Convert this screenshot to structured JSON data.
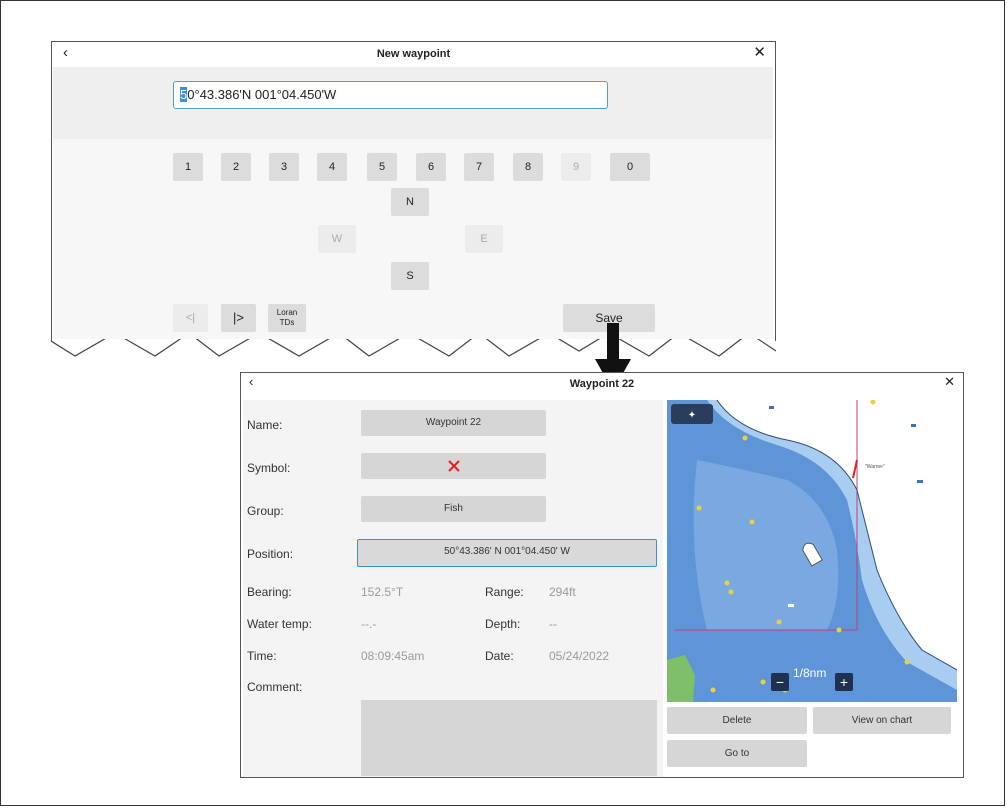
{
  "new_waypoint_dialog": {
    "back_icon": "chevron-left-icon",
    "title": "New waypoint",
    "close_icon": "close-icon",
    "position_first_char": "5",
    "position_rest": "0°43.386'N  001°04.450'W",
    "digit_keys": [
      "1",
      "2",
      "3",
      "4",
      "5",
      "6",
      "7",
      "8",
      "9",
      "0"
    ],
    "disabled_digit": "9",
    "dir_keys": {
      "n": "N",
      "w": "W",
      "e": "E",
      "s": "S"
    },
    "cursor_left_label": "<|",
    "cursor_right_label": "|>",
    "loran_label_1": "Loran",
    "loran_label_2": "TDs",
    "save_label": "Save"
  },
  "waypoint_dialog": {
    "back_icon": "chevron-left-icon",
    "title": "Waypoint 22",
    "close_icon": "close-icon",
    "name_label": "Name:",
    "name_value": "Waypoint 22",
    "symbol_label": "Symbol:",
    "symbol_icon": "red-cross-icon",
    "group_label": "Group:",
    "group_value": "Fish",
    "position_label": "Position:",
    "position_value": "50°43.386' N  001°04.450' W",
    "bearing_label": "Bearing:",
    "bearing_value": "152.5°T",
    "range_label": "Range:",
    "range_value": "294ft",
    "watertemp_label": "Water temp:",
    "watertemp_value": "--.-",
    "depth_label": "Depth:",
    "depth_value": "--",
    "time_label": "Time:",
    "time_value": "08:09:45am",
    "date_label": "Date:",
    "date_value": "05/24/2022",
    "comment_label": "Comment:",
    "chart_scale": "1/8nm",
    "chart_label": "\"Warner\"",
    "delete_label": "Delete",
    "view_on_chart_label": "View on chart",
    "go_to_label": "Go to"
  },
  "colors": {
    "accent_blue": "#3b8fd6",
    "deep_water": "#5a8fd2",
    "shallow_water": "#a9cdf0",
    "land": "#ffffff",
    "symbol_red": "#e02020"
  }
}
